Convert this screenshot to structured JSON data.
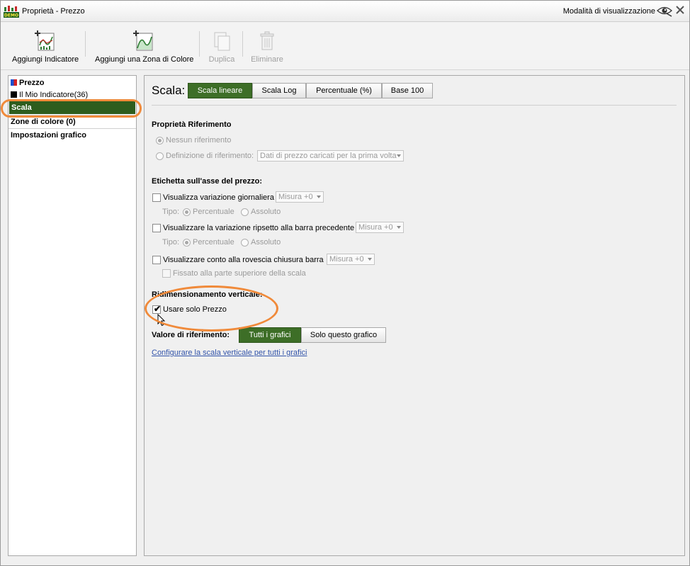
{
  "window": {
    "title": "Proprietà - Prezzo",
    "view_mode_label": "Modalità di visualizzazione"
  },
  "toolbar": {
    "add_indicator": "Aggiungi Indicatore",
    "add_color_zone": "Aggiungi una Zona di Colore",
    "duplicate": "Duplica",
    "delete": "Eliminare"
  },
  "sidebar": {
    "items": [
      {
        "label": "Prezzo",
        "swatch": "#1a4fd0"
      },
      {
        "label": "Il Mio Indicatore(36)",
        "swatch": "#000000"
      },
      {
        "label": "Scala"
      },
      {
        "label": "Zone di colore (0)"
      },
      {
        "label": "Impostazioni grafico"
      }
    ]
  },
  "scale": {
    "label": "Scala:",
    "options": [
      "Scala lineare",
      "Scala Log",
      "Percentuale (%)",
      "Base 100"
    ],
    "selected": "Scala lineare"
  },
  "reference": {
    "heading": "Proprietà Riferimento",
    "no_reference": "Nessun riferimento",
    "definition_label": "Definizione di riferimento:",
    "definition_value": "Dati di prezzo caricati per la prima volta"
  },
  "price_axis": {
    "heading": "Etichetta sull'asse del prezzo:",
    "daily_change": "Visualizza variazione giornaliera",
    "daily_change_measure": "Misura +0",
    "type_label": "Tipo:",
    "percent": "Percentuale",
    "absolute": "Assoluto",
    "prev_bar_change": "Visualizzare la variazione ripsetto alla barra precedente",
    "prev_bar_measure": "Misura +0",
    "type_label_2": "Tipo:",
    "percent_2": "Percentuale",
    "absolute_2": "Assoluto",
    "countdown": "Visualizzare conto alla rovescia chiusura barra",
    "countdown_measure": "Misura +0",
    "fixed_top": "Fissato alla parte superiore della scala"
  },
  "vertical_resize": {
    "heading": "Ridimensionamento verticale:",
    "use_price_only": "Usare solo Prezzo",
    "use_price_only_checked": true
  },
  "reference_value": {
    "label": "Valore di riferimento:",
    "options": [
      "Tutti i grafici",
      "Solo questo grafico"
    ],
    "selected": "Tutti i grafici"
  },
  "configure_link": "Configurare la scala verticale per tutti i grafici",
  "colors": {
    "accent_green": "#3d6e27",
    "highlight_orange": "#f08a3a"
  }
}
